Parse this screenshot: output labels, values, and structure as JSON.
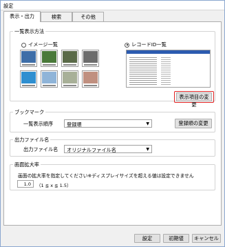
{
  "window": {
    "title": "設定"
  },
  "tabs": [
    {
      "label": "表示・出力"
    },
    {
      "label": "検索"
    },
    {
      "label": "その他"
    }
  ],
  "list_display": {
    "group_label": "一覧表示方法",
    "option_image": "イメージ一覧",
    "option_record": "レコードID一覧",
    "selected": "レコードID一覧",
    "change_items_button": "表示項目の変更"
  },
  "bookmark": {
    "group_label": "ブックマーク",
    "order_label": "一覧表示順序",
    "order_value": "登録順",
    "change_order_button": "登録順の変更"
  },
  "output_filename": {
    "group_label": "出力ファイル名",
    "label": "出力ファイル名",
    "value": "オリジナルファイル名"
  },
  "zoom": {
    "group_label": "画面拡大率",
    "description": "画面の拡大率を指定してください※ディスプレイサイズを超える値は設定できません",
    "value": "1.0",
    "range": "（1 ≦ x ≦ 1.5）"
  },
  "footer": {
    "ok_button": "設定",
    "reset_button": "初期値",
    "cancel_button": "キャンセル"
  },
  "colors": {
    "highlight": "#e02020",
    "window_border": "#8aa7cf"
  }
}
